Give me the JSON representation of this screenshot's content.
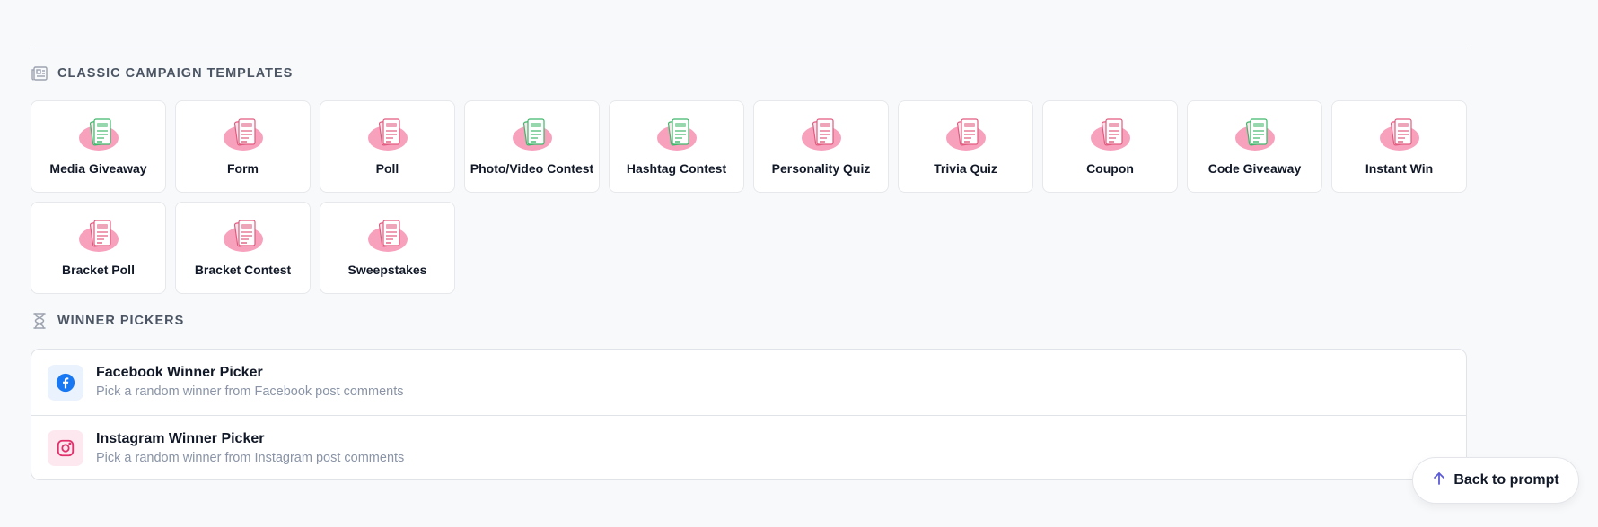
{
  "sections": {
    "templates_title": "CLASSIC CAMPAIGN TEMPLATES",
    "winners_title": "WINNER PICKERS"
  },
  "templates": [
    {
      "label": "Media Giveaway",
      "icon": "media-giveaway-icon",
      "accent": "#3fb66b"
    },
    {
      "label": "Form",
      "icon": "form-icon",
      "accent": "#e25b7f"
    },
    {
      "label": "Poll",
      "icon": "poll-icon",
      "accent": "#e25b7f"
    },
    {
      "label": "Photo/Video Contest",
      "icon": "photo-video-contest-icon",
      "accent": "#3fb66b"
    },
    {
      "label": "Hashtag Contest",
      "icon": "hashtag-contest-icon",
      "accent": "#3fb66b"
    },
    {
      "label": "Personality Quiz",
      "icon": "personality-quiz-icon",
      "accent": "#e25b7f"
    },
    {
      "label": "Trivia Quiz",
      "icon": "trivia-quiz-icon",
      "accent": "#e25b7f"
    },
    {
      "label": "Coupon",
      "icon": "coupon-icon",
      "accent": "#e25b7f"
    },
    {
      "label": "Code Giveaway",
      "icon": "code-giveaway-icon",
      "accent": "#3fb66b"
    },
    {
      "label": "Instant Win",
      "icon": "instant-win-icon",
      "accent": "#e25b7f"
    },
    {
      "label": "Bracket Poll",
      "icon": "bracket-poll-icon",
      "accent": "#e25b7f"
    },
    {
      "label": "Bracket Contest",
      "icon": "bracket-contest-icon",
      "accent": "#e25b7f"
    },
    {
      "label": "Sweepstakes",
      "icon": "sweepstakes-icon",
      "accent": "#e25b7f"
    }
  ],
  "pickers": [
    {
      "title": "Facebook Winner Picker",
      "subtitle": "Pick a random winner from Facebook post comments",
      "icon": "facebook-icon",
      "color": "#1877f2"
    },
    {
      "title": "Instagram Winner Picker",
      "subtitle": "Pick a random winner from Instagram post comments",
      "icon": "instagram-icon",
      "color": "#e1306c"
    }
  ],
  "back_button": {
    "label": "Back to prompt",
    "icon": "arrow-up-icon",
    "color": "#5b5bd6"
  },
  "colors": {
    "tile_blob": "#f7a1bd",
    "page_bg": "#f8f9fb"
  }
}
